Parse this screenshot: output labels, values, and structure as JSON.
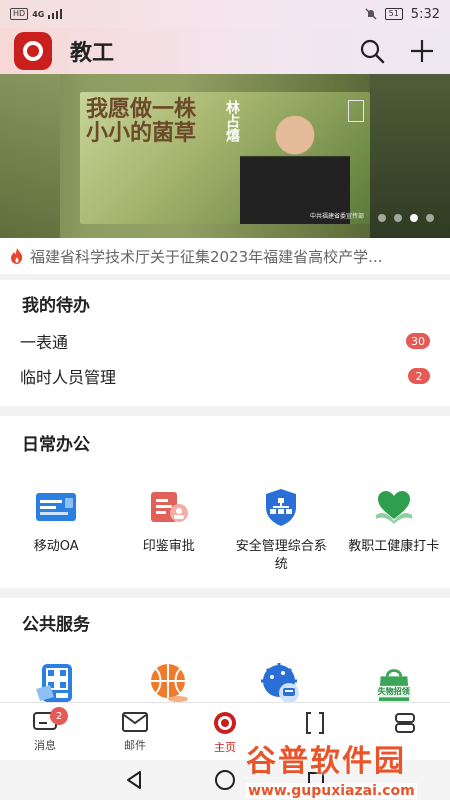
{
  "status_bar": {
    "network_badge": "HD",
    "signal": "4G",
    "battery": "51",
    "time": "5:32"
  },
  "header": {
    "title": "教工"
  },
  "banner": {
    "headline": "我愿做一株小小的菌草",
    "person_name": "林占熺",
    "caption": "中共福建省委宣传部",
    "slide_count": 4,
    "active_slide": 2
  },
  "notice": {
    "text": "福建省科学技术厅关于征集2023年福建省高校产学..."
  },
  "todo": {
    "title": "我的待办",
    "items": [
      {
        "label": "一表通",
        "count": "30"
      },
      {
        "label": "临时人员管理",
        "count": "2"
      }
    ]
  },
  "daily": {
    "title": "日常办公",
    "items": [
      {
        "label": "移动OA",
        "icon": "oa-icon"
      },
      {
        "label": "印鉴审批",
        "icon": "seal-approval-icon"
      },
      {
        "label": "安全管理综合系统",
        "icon": "security-shield-icon"
      },
      {
        "label": "教职工健康打卡",
        "icon": "health-checkin-icon"
      }
    ]
  },
  "public": {
    "title": "公共服务",
    "items": [
      {
        "icon": "payment-qr-icon"
      },
      {
        "icon": "sports-ball-icon"
      },
      {
        "icon": "campus-bus-icon"
      },
      {
        "icon": "lost-and-found-icon",
        "text": "失物招领"
      }
    ]
  },
  "tabbar": {
    "items": [
      {
        "label": "消息",
        "badge": "2"
      },
      {
        "label": "邮件"
      },
      {
        "label": "主页",
        "active": true
      },
      {
        "label": ""
      },
      {
        "label": ""
      }
    ]
  },
  "watermark": {
    "main": "谷普软件园",
    "url": "www.gupuxiazai.com"
  },
  "colors": {
    "accent": "#c9201e",
    "badge": "#e65a55",
    "oa_blue": "#2b7fe0",
    "seal_red": "#e0605a",
    "shield_blue": "#2a6fd6",
    "health_green": "#2f9e4e",
    "ball_orange": "#f07a2a"
  }
}
